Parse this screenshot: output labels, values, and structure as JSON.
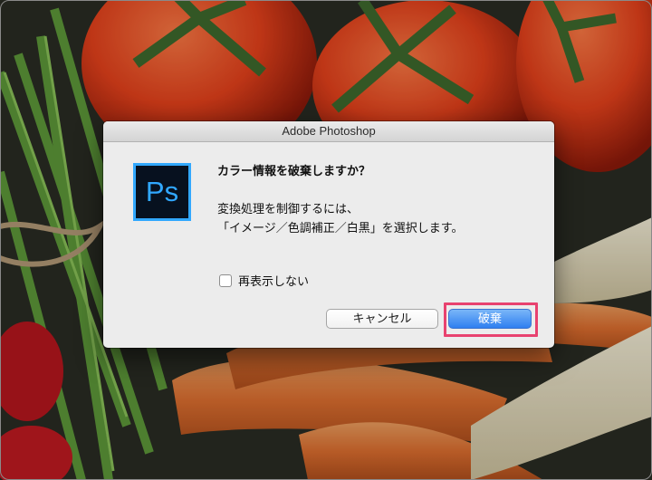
{
  "window": {
    "title": "Adobe Photoshop"
  },
  "app_icon": {
    "name": "photoshop-icon",
    "text": "Ps",
    "color": "#31a8ff"
  },
  "dialog": {
    "question": "カラー情報を破棄しますか？",
    "message_line1": "変換処理を制御するには、",
    "message_line2": "「イメージ／色調補正／白黒」を選択します。",
    "checkbox_label": "再表示しない",
    "checkbox_checked": false,
    "cancel_label": "キャンセル",
    "discard_label": "破棄"
  },
  "colors": {
    "primary_button": "#2f7ff0",
    "highlight": "#e8426f"
  }
}
